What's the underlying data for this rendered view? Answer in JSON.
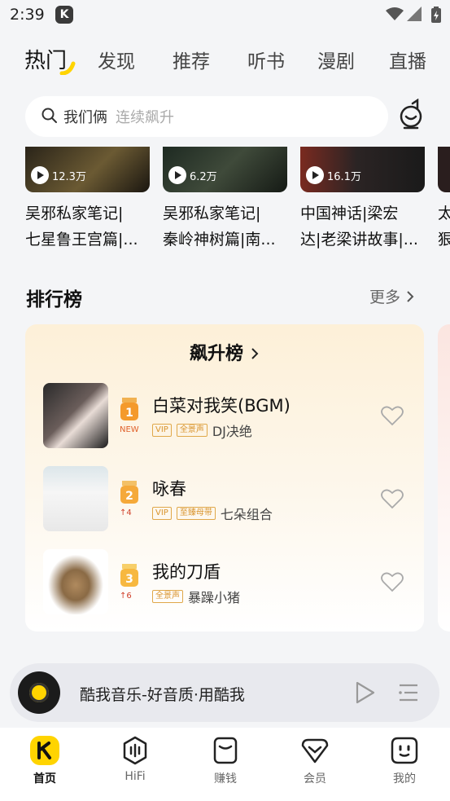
{
  "status_bar": {
    "time": "2:39"
  },
  "tabs": [
    {
      "label": "热门",
      "active": true
    },
    {
      "label": "发现"
    },
    {
      "label": "推荐"
    },
    {
      "label": "听书"
    },
    {
      "label": "漫剧"
    },
    {
      "label": "直播"
    }
  ],
  "search": {
    "keyword": "我们俩",
    "hint": "连续飙升"
  },
  "cards": [
    {
      "plays": "12.3万",
      "line1": "吴邪私家笔记|",
      "line2": "七星鲁王宫篇|..."
    },
    {
      "plays": "6.2万",
      "line1": "吴邪私家笔记|",
      "line2": "秦岭神树篇|南..."
    },
    {
      "plays": "16.1万",
      "line1": "中国神话|梁宏",
      "line2": "达|老梁讲故事|..."
    },
    {
      "plays": "",
      "line1": "太",
      "line2": "狠"
    }
  ],
  "section": {
    "title": "排行榜",
    "more": "更多"
  },
  "chart": {
    "title": "飙升榜",
    "songs": [
      {
        "rank": "1",
        "trend": "NEW",
        "title": "白菜对我笑(BGM)",
        "tags": [
          "VIP",
          "全景声"
        ],
        "artist": "DJ决绝"
      },
      {
        "rank": "2",
        "trend": "↑4",
        "title": "咏春",
        "tags": [
          "VIP",
          "至臻母带"
        ],
        "artist": "七朵组合"
      },
      {
        "rank": "3",
        "trend": "↑6",
        "title": "我的刀盾",
        "tags": [
          "全景声"
        ],
        "artist": "暴躁小猪"
      }
    ]
  },
  "player": {
    "title": "酷我音乐-好音质·用酷我"
  },
  "bottom_nav": [
    {
      "label": "首页",
      "icon": "home-logo-icon",
      "active": true
    },
    {
      "label": "HiFi",
      "icon": "hifi-icon"
    },
    {
      "label": "赚钱",
      "icon": "earn-icon"
    },
    {
      "label": "会员",
      "icon": "vip-icon"
    },
    {
      "label": "我的",
      "icon": "profile-icon"
    }
  ],
  "colors": {
    "accent": "#ffd400",
    "tag": "#d9932c",
    "rank_bg": "#fdf0d8"
  }
}
